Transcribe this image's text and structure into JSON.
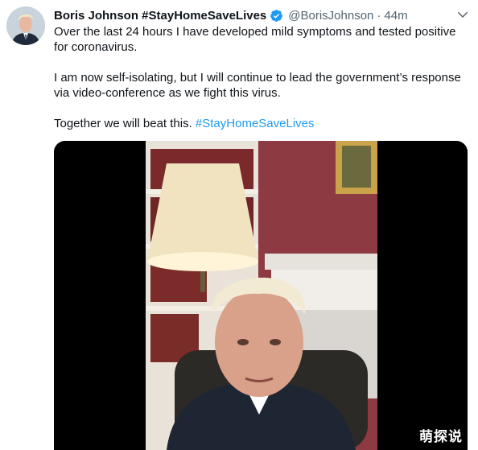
{
  "tweet": {
    "author_name": "Boris Johnson #StayHomeSaveLives",
    "handle": "@BorisJohnson",
    "separator": "·",
    "time": "44m",
    "paragraph1": "Over the last 24 hours I have developed mild symptoms and tested positive for coronavirus.",
    "paragraph2": "I am now self-isolating, but I will continue to lead the government’s response via video-conference as we fight this virus.",
    "paragraph3_text": "Together we will beat this. ",
    "paragraph3_hashtag": "#StayHomeSaveLives",
    "verified_icon": "verified-badge-icon",
    "menu_icon": "chevron-down-icon"
  },
  "watermark": "萌探说",
  "colors": {
    "accent": "#1d9bf0",
    "secondary_text": "#536471",
    "wall": "#8e3a42"
  }
}
